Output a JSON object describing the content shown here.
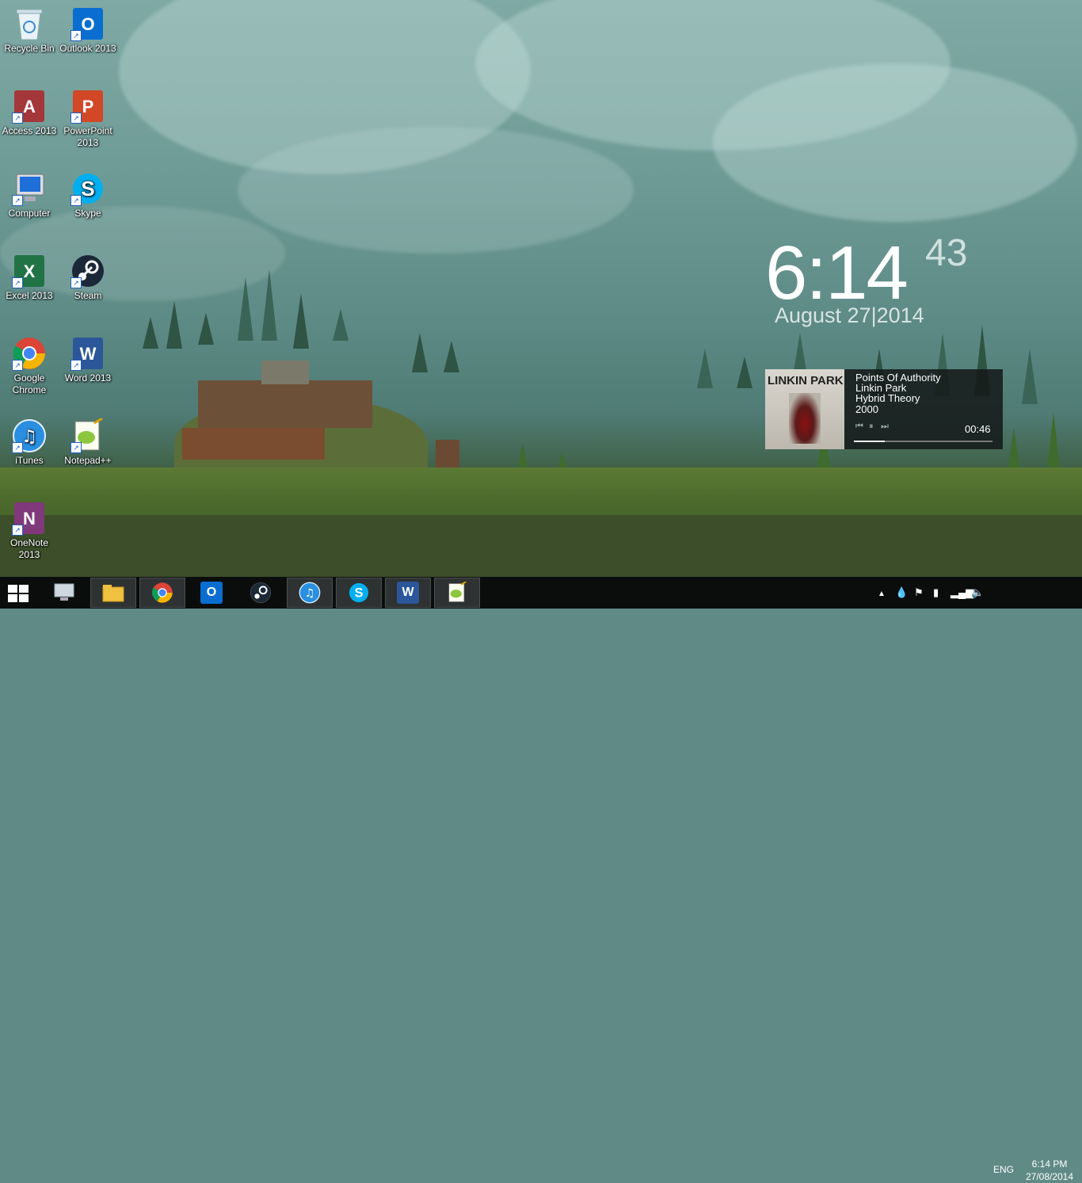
{
  "desktop": {
    "icons": [
      {
        "label": "Recycle Bin"
      },
      {
        "label": "Outlook 2013"
      },
      {
        "label": "Access 2013"
      },
      {
        "label": "PowerPoint 2013"
      },
      {
        "label": "Computer"
      },
      {
        "label": "Skype"
      },
      {
        "label": "Excel 2013"
      },
      {
        "label": "Steam"
      },
      {
        "label": "Google Chrome"
      },
      {
        "label": "Word 2013"
      },
      {
        "label": "iTunes"
      },
      {
        "label": "Notepad++"
      },
      {
        "label": "OneNote 2013"
      }
    ]
  },
  "clock_widget": {
    "time": "6:14",
    "seconds": "43",
    "date": "August 27|2014"
  },
  "music_widget": {
    "album_art_text": "LINKIN PARK",
    "track": "Points Of Authority",
    "artist": "Linkin Park",
    "album": "Hybrid Theory",
    "year": "2000",
    "elapsed": "00:46",
    "progress_fraction": 0.22,
    "controls": [
      "prev-icon",
      "pause-icon",
      "next-icon"
    ]
  },
  "taskbar": {
    "pinned": [
      "explorer-monitor-icon",
      "file-explorer-icon",
      "chrome-icon",
      "outlook-icon",
      "steam-icon",
      "itunes-icon",
      "skype-icon",
      "word-icon",
      "notepadpp-icon"
    ],
    "tray": {
      "language": "ENG",
      "time": "6:14 PM",
      "date": "27/08/2014"
    }
  },
  "colors": {
    "taskbar": "#0b0d0d",
    "outlook": "#0a6ed1",
    "access": "#a4373a",
    "powerpoint": "#d24726",
    "excel": "#217346",
    "word": "#2b579a",
    "onenote": "#80397b",
    "skype": "#00aff0"
  }
}
